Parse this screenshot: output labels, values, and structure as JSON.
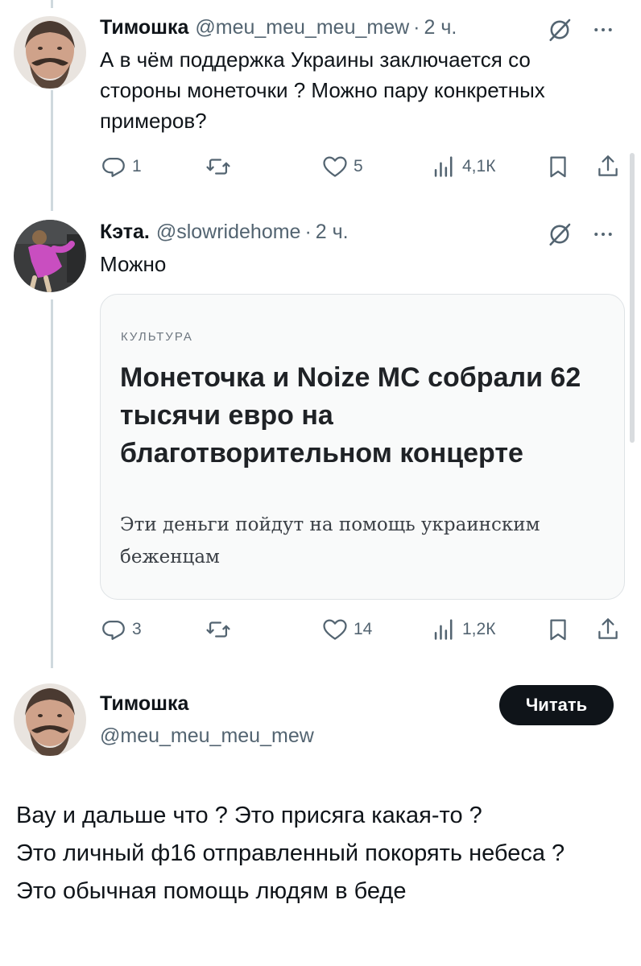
{
  "tweets": [
    {
      "author": "Тимошка",
      "handle": "@meu_meu_meu_mew",
      "separator": "·",
      "time": "2 ч.",
      "text": "А в чём поддержка Украины заключается со стороны монеточки ? Можно пару конкретных примеров?",
      "replies": "1",
      "retweets": "",
      "likes": "5",
      "views": "4,1К"
    },
    {
      "author": "Кэта.",
      "handle": "@slowridehome",
      "separator": "·",
      "time": "2 ч.",
      "text": "Можно",
      "card": {
        "section": "КУЛЬТУРА",
        "title": "Монеточка и Noize MC собрали 62 тысячи евро на благотворительном концерте",
        "subtitle": "Эти деньги пойдут на помощь украинским беженцам"
      },
      "replies": "3",
      "retweets": "",
      "likes": "14",
      "views": "1,2К"
    }
  ],
  "main_post": {
    "author": "Тимошка",
    "handle": "@meu_meu_meu_mew",
    "follow_label": "Читать",
    "lines": [
      "Вау и дальше что ? Это присяга какая-то ?",
      "Это личный ф16 отправленный покорять небеса ?",
      "Это обычная помощь людям в беде"
    ]
  },
  "icons": {
    "reply": "reply-icon",
    "retweet": "retweet-icon",
    "like": "heart-icon",
    "views": "views-icon",
    "bookmark": "bookmark-icon",
    "share": "share-icon",
    "grok": "grok-icon",
    "more": "more-icon"
  },
  "colors": {
    "text": "#0f1419",
    "secondary": "#536471",
    "thread_line": "#cfd9de",
    "button_bg": "#0f1419",
    "card_bg": "#f9fafa"
  }
}
